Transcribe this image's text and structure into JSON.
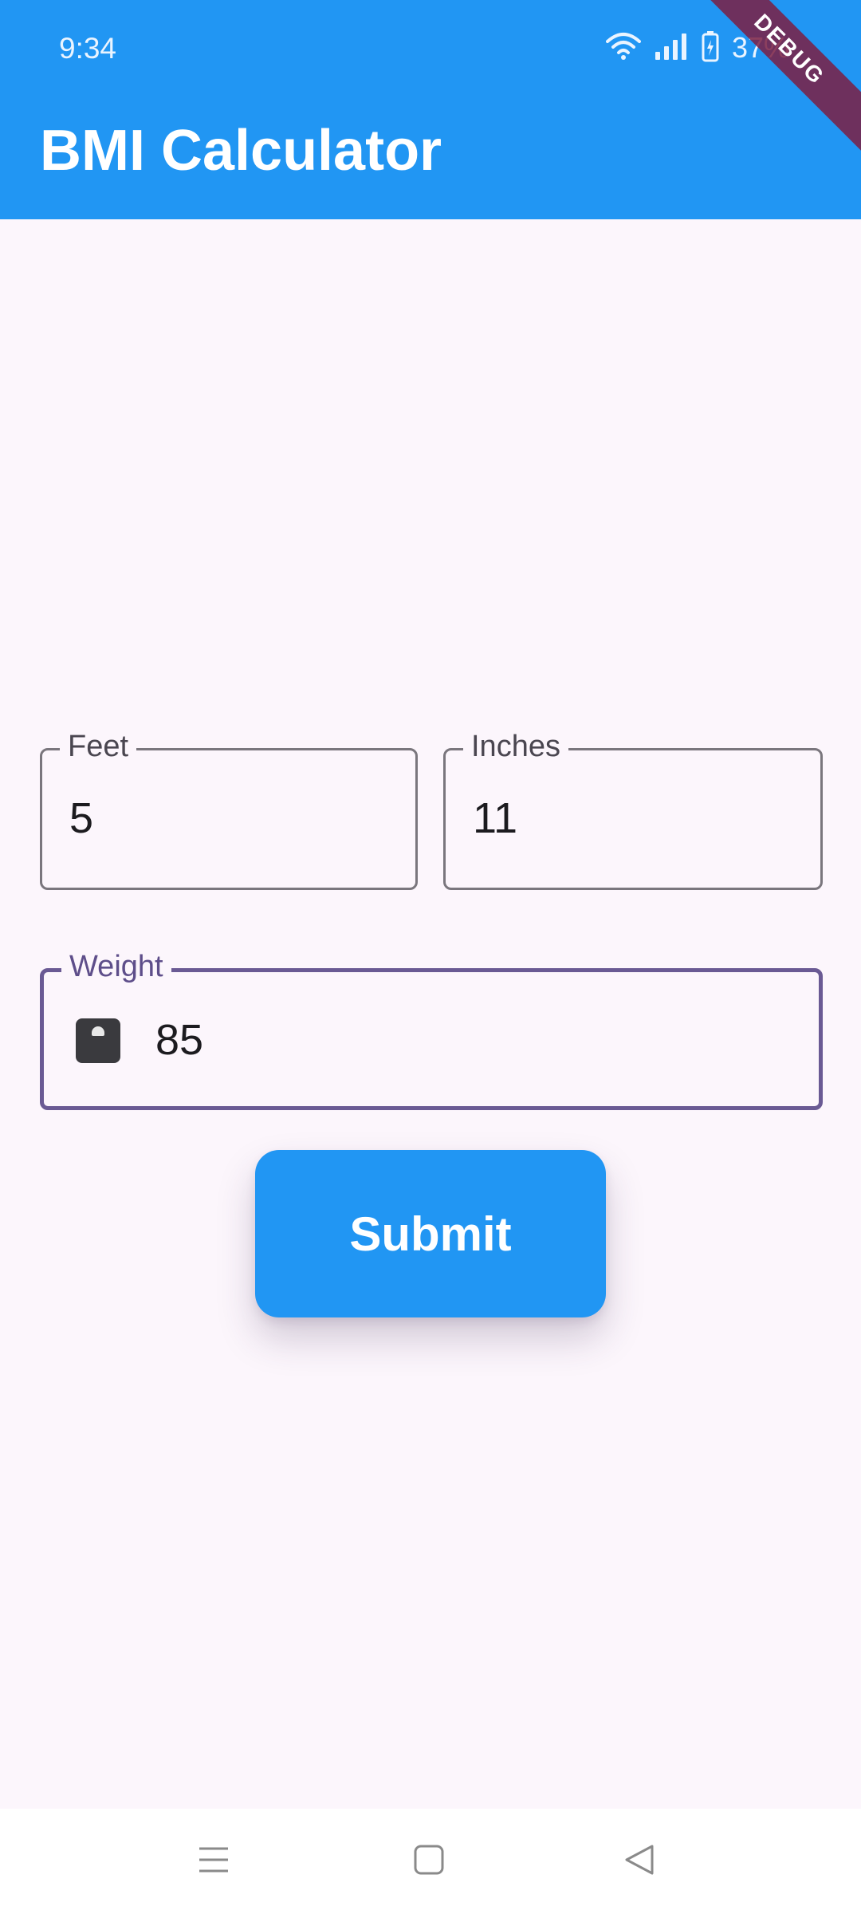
{
  "status_bar": {
    "time": "9:34",
    "battery_percent": "37%",
    "icons": [
      "wifi-icon",
      "signal-icon",
      "battery-charging-icon"
    ]
  },
  "app_bar": {
    "title": "BMI Calculator",
    "debug_banner": "DEBUG",
    "color": "#2196F3"
  },
  "form": {
    "feet": {
      "label": "Feet",
      "value": "5"
    },
    "inches": {
      "label": "Inches",
      "value": "11"
    },
    "weight": {
      "label": "Weight",
      "value": "85",
      "icon": "scale-icon"
    },
    "submit_label": "Submit"
  },
  "nav_bar": {
    "icons": [
      "menu-icon",
      "home-square-icon",
      "back-triangle-icon"
    ]
  }
}
